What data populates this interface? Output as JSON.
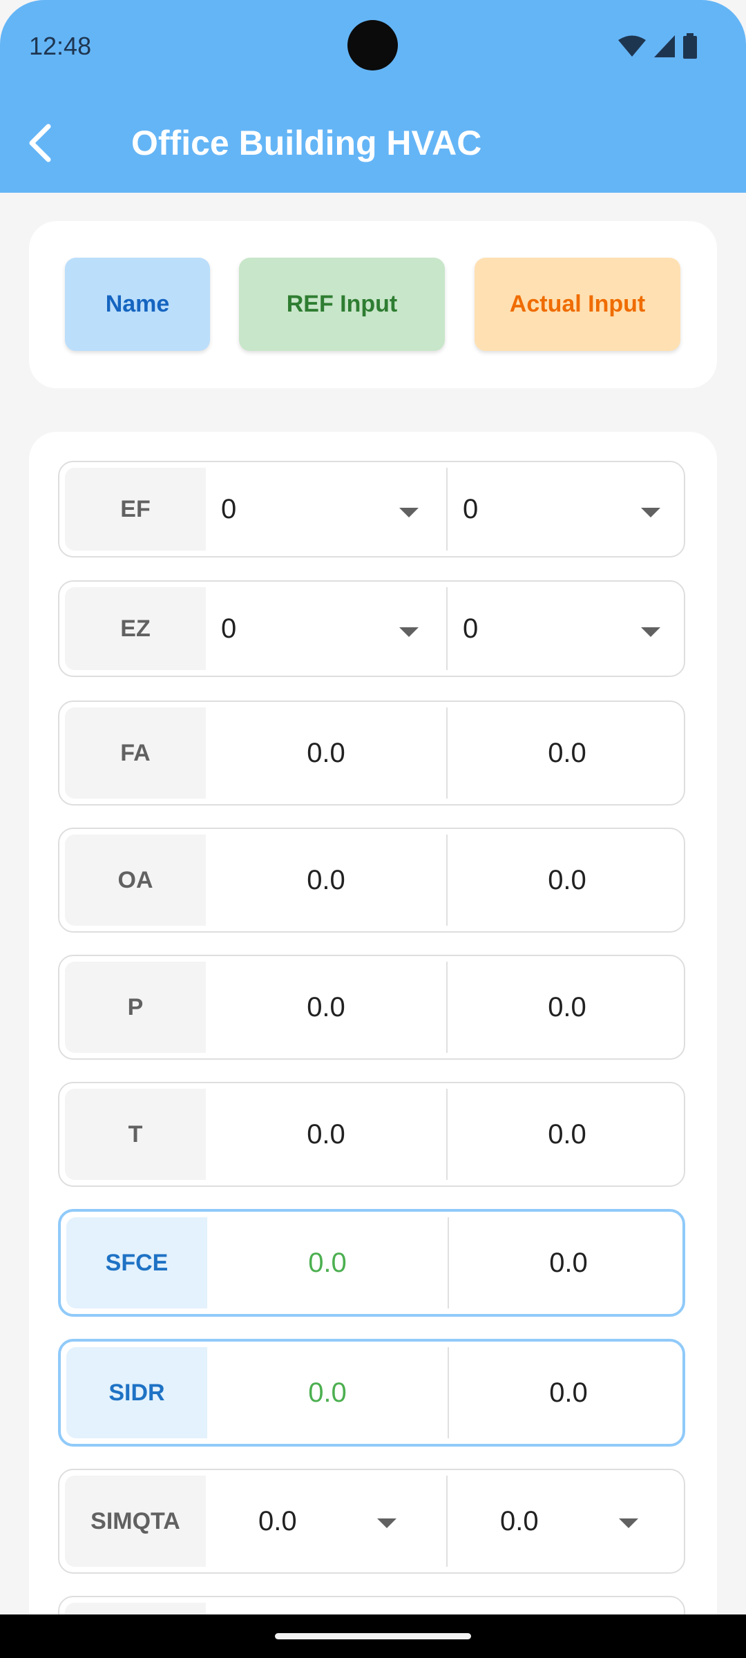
{
  "status": {
    "time": "12:48"
  },
  "header": {
    "title": "Office Building HVAC"
  },
  "legend": {
    "name": "Name",
    "ref": "REF Input",
    "actual": "Actual Input"
  },
  "rows": [
    {
      "label": "EF",
      "ref": "0",
      "actual": "0"
    },
    {
      "label": "EZ",
      "ref": "0",
      "actual": "0"
    },
    {
      "label": "FA",
      "ref": "0.0",
      "actual": "0.0"
    },
    {
      "label": "OA",
      "ref": "0.0",
      "actual": "0.0"
    },
    {
      "label": "P",
      "ref": "0.0",
      "actual": "0.0"
    },
    {
      "label": "T",
      "ref": "0.0",
      "actual": "0.0"
    },
    {
      "label": "SFCE",
      "ref": "0.0",
      "actual": "0.0"
    },
    {
      "label": "SIDR",
      "ref": "0.0",
      "actual": "0.0"
    },
    {
      "label": "SIMQTA",
      "ref": "0.0",
      "actual": "0.0"
    }
  ],
  "colors": {
    "header": "#64b5f6",
    "name_chip": "#bbdefb",
    "ref_chip": "#c8e6c9",
    "actual_chip": "#ffe0b2",
    "highlight_border": "#90caf9",
    "ref_highlight_text": "#4caf50"
  },
  "icons": [
    "back-arrow-icon",
    "wifi-icon",
    "cellular-signal-icon",
    "battery-icon",
    "dropdown-arrow-icon"
  ]
}
